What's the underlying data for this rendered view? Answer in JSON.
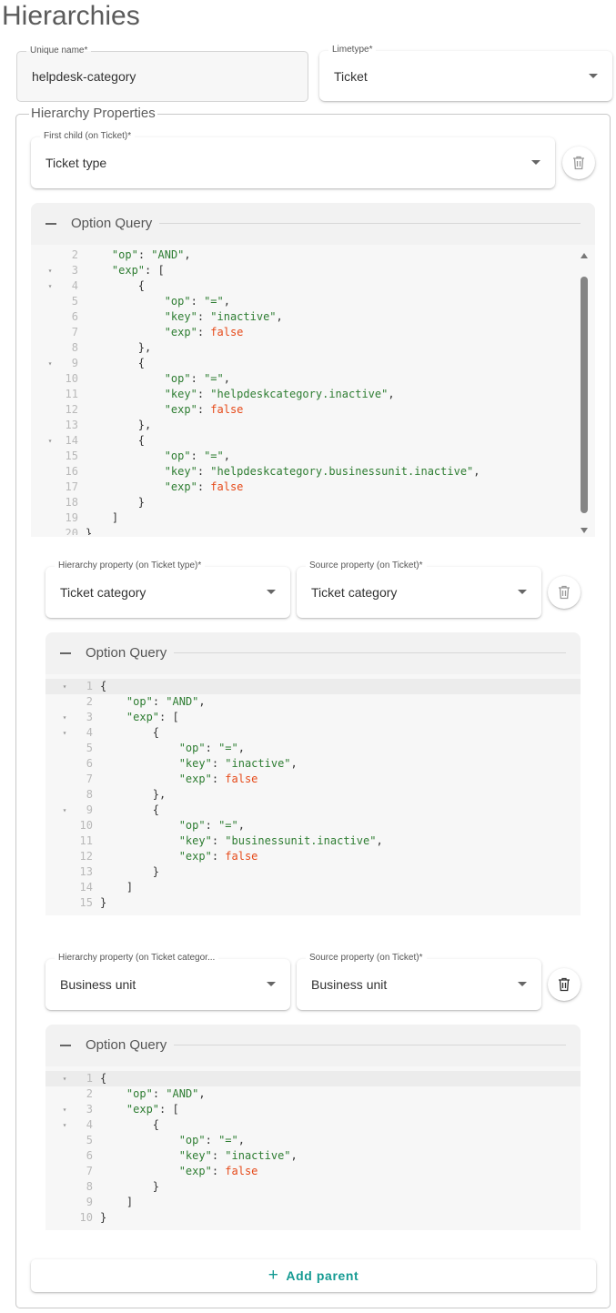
{
  "page": {
    "title": "Hierarchies"
  },
  "form": {
    "unique_name": {
      "label": "Unique name*",
      "value": "helpdesk-category"
    },
    "limetype": {
      "label": "Limetype*",
      "value": "Ticket"
    }
  },
  "hierarchy": {
    "legend": "Hierarchy Properties",
    "first_child": {
      "label": "First child (on Ticket)*",
      "value": "Ticket type",
      "option_query": {
        "title": "Option Query",
        "lines": [
          {
            "n": "2",
            "fold": "",
            "code": [
              [
                "t",
                "    "
              ],
              [
                "s",
                "\"op\""
              ],
              [
                "t",
                ": "
              ],
              [
                "s",
                "\"AND\""
              ],
              [
                "t",
                ","
              ]
            ]
          },
          {
            "n": "3",
            "fold": "▾",
            "code": [
              [
                "t",
                "    "
              ],
              [
                "s",
                "\"exp\""
              ],
              [
                "t",
                ": ["
              ]
            ]
          },
          {
            "n": "4",
            "fold": "▾",
            "code": [
              [
                "t",
                "        {"
              ]
            ]
          },
          {
            "n": "5",
            "fold": "",
            "code": [
              [
                "t",
                "            "
              ],
              [
                "s",
                "\"op\""
              ],
              [
                "t",
                ": "
              ],
              [
                "s",
                "\"=\""
              ],
              [
                "t",
                ","
              ]
            ]
          },
          {
            "n": "6",
            "fold": "",
            "code": [
              [
                "t",
                "            "
              ],
              [
                "s",
                "\"key\""
              ],
              [
                "t",
                ": "
              ],
              [
                "s",
                "\"inactive\""
              ],
              [
                "t",
                ","
              ]
            ]
          },
          {
            "n": "7",
            "fold": "",
            "code": [
              [
                "t",
                "            "
              ],
              [
                "s",
                "\"exp\""
              ],
              [
                "t",
                ": "
              ],
              [
                "b",
                "false"
              ]
            ]
          },
          {
            "n": "8",
            "fold": "",
            "code": [
              [
                "t",
                "        },"
              ]
            ]
          },
          {
            "n": "9",
            "fold": "▾",
            "code": [
              [
                "t",
                "        {"
              ]
            ]
          },
          {
            "n": "10",
            "fold": "",
            "code": [
              [
                "t",
                "            "
              ],
              [
                "s",
                "\"op\""
              ],
              [
                "t",
                ": "
              ],
              [
                "s",
                "\"=\""
              ],
              [
                "t",
                ","
              ]
            ]
          },
          {
            "n": "11",
            "fold": "",
            "code": [
              [
                "t",
                "            "
              ],
              [
                "s",
                "\"key\""
              ],
              [
                "t",
                ": "
              ],
              [
                "s",
                "\"helpdeskcategory.inactive\""
              ],
              [
                "t",
                ","
              ]
            ]
          },
          {
            "n": "12",
            "fold": "",
            "code": [
              [
                "t",
                "            "
              ],
              [
                "s",
                "\"exp\""
              ],
              [
                "t",
                ": "
              ],
              [
                "b",
                "false"
              ]
            ]
          },
          {
            "n": "13",
            "fold": "",
            "code": [
              [
                "t",
                "        },"
              ]
            ]
          },
          {
            "n": "14",
            "fold": "▾",
            "code": [
              [
                "t",
                "        {"
              ]
            ]
          },
          {
            "n": "15",
            "fold": "",
            "code": [
              [
                "t",
                "            "
              ],
              [
                "s",
                "\"op\""
              ],
              [
                "t",
                ": "
              ],
              [
                "s",
                "\"=\""
              ],
              [
                "t",
                ","
              ]
            ]
          },
          {
            "n": "16",
            "fold": "",
            "code": [
              [
                "t",
                "            "
              ],
              [
                "s",
                "\"key\""
              ],
              [
                "t",
                ": "
              ],
              [
                "s",
                "\"helpdeskcategory.businessunit.inactive\""
              ],
              [
                "t",
                ","
              ]
            ]
          },
          {
            "n": "17",
            "fold": "",
            "code": [
              [
                "t",
                "            "
              ],
              [
                "s",
                "\"exp\""
              ],
              [
                "t",
                ": "
              ],
              [
                "b",
                "false"
              ]
            ]
          },
          {
            "n": "18",
            "fold": "",
            "code": [
              [
                "t",
                "        }"
              ]
            ]
          },
          {
            "n": "19",
            "fold": "",
            "code": [
              [
                "t",
                "    ]"
              ]
            ]
          },
          {
            "n": "20",
            "fold": "",
            "code": [
              [
                "t",
                "}"
              ]
            ]
          }
        ]
      }
    },
    "levels": [
      {
        "hierarchy_label": "Hierarchy property (on Ticket type)*",
        "hierarchy_value": "Ticket category",
        "source_label": "Source property (on Ticket)*",
        "source_value": "Ticket category",
        "option_query": {
          "title": "Option Query",
          "lines": [
            {
              "n": "1",
              "fold": "▾",
              "active": true,
              "code": [
                [
                  "t",
                  "{"
                ]
              ]
            },
            {
              "n": "2",
              "fold": "",
              "code": [
                [
                  "t",
                  "    "
                ],
                [
                  "s",
                  "\"op\""
                ],
                [
                  "t",
                  ": "
                ],
                [
                  "s",
                  "\"AND\""
                ],
                [
                  "t",
                  ","
                ]
              ]
            },
            {
              "n": "3",
              "fold": "▾",
              "code": [
                [
                  "t",
                  "    "
                ],
                [
                  "s",
                  "\"exp\""
                ],
                [
                  "t",
                  ": ["
                ]
              ]
            },
            {
              "n": "4",
              "fold": "▾",
              "code": [
                [
                  "t",
                  "        {"
                ]
              ]
            },
            {
              "n": "5",
              "fold": "",
              "code": [
                [
                  "t",
                  "            "
                ],
                [
                  "s",
                  "\"op\""
                ],
                [
                  "t",
                  ": "
                ],
                [
                  "s",
                  "\"=\""
                ],
                [
                  "t",
                  ","
                ]
              ]
            },
            {
              "n": "6",
              "fold": "",
              "code": [
                [
                  "t",
                  "            "
                ],
                [
                  "s",
                  "\"key\""
                ],
                [
                  "t",
                  ": "
                ],
                [
                  "s",
                  "\"inactive\""
                ],
                [
                  "t",
                  ","
                ]
              ]
            },
            {
              "n": "7",
              "fold": "",
              "code": [
                [
                  "t",
                  "            "
                ],
                [
                  "s",
                  "\"exp\""
                ],
                [
                  "t",
                  ": "
                ],
                [
                  "b",
                  "false"
                ]
              ]
            },
            {
              "n": "8",
              "fold": "",
              "code": [
                [
                  "t",
                  "        },"
                ]
              ]
            },
            {
              "n": "9",
              "fold": "▾",
              "code": [
                [
                  "t",
                  "        {"
                ]
              ]
            },
            {
              "n": "10",
              "fold": "",
              "code": [
                [
                  "t",
                  "            "
                ],
                [
                  "s",
                  "\"op\""
                ],
                [
                  "t",
                  ": "
                ],
                [
                  "s",
                  "\"=\""
                ],
                [
                  "t",
                  ","
                ]
              ]
            },
            {
              "n": "11",
              "fold": "",
              "code": [
                [
                  "t",
                  "            "
                ],
                [
                  "s",
                  "\"key\""
                ],
                [
                  "t",
                  ": "
                ],
                [
                  "s",
                  "\"businessunit.inactive\""
                ],
                [
                  "t",
                  ","
                ]
              ]
            },
            {
              "n": "12",
              "fold": "",
              "code": [
                [
                  "t",
                  "            "
                ],
                [
                  "s",
                  "\"exp\""
                ],
                [
                  "t",
                  ": "
                ],
                [
                  "b",
                  "false"
                ]
              ]
            },
            {
              "n": "13",
              "fold": "",
              "code": [
                [
                  "t",
                  "        }"
                ]
              ]
            },
            {
              "n": "14",
              "fold": "",
              "code": [
                [
                  "t",
                  "    ]"
                ]
              ]
            },
            {
              "n": "15",
              "fold": "",
              "code": [
                [
                  "t",
                  "}"
                ]
              ]
            }
          ]
        }
      },
      {
        "hierarchy_label": "Hierarchy property (on Ticket categor...",
        "hierarchy_value": "Business unit",
        "source_label": "Source property (on Ticket)*",
        "source_value": "Business unit",
        "option_query": {
          "title": "Option Query",
          "lines": [
            {
              "n": "1",
              "fold": "▾",
              "active": true,
              "code": [
                [
                  "t",
                  "{"
                ]
              ]
            },
            {
              "n": "2",
              "fold": "",
              "code": [
                [
                  "t",
                  "    "
                ],
                [
                  "s",
                  "\"op\""
                ],
                [
                  "t",
                  ": "
                ],
                [
                  "s",
                  "\"AND\""
                ],
                [
                  "t",
                  ","
                ]
              ]
            },
            {
              "n": "3",
              "fold": "▾",
              "code": [
                [
                  "t",
                  "    "
                ],
                [
                  "s",
                  "\"exp\""
                ],
                [
                  "t",
                  ": ["
                ]
              ]
            },
            {
              "n": "4",
              "fold": "▾",
              "code": [
                [
                  "t",
                  "        {"
                ]
              ]
            },
            {
              "n": "5",
              "fold": "",
              "code": [
                [
                  "t",
                  "            "
                ],
                [
                  "s",
                  "\"op\""
                ],
                [
                  "t",
                  ": "
                ],
                [
                  "s",
                  "\"=\""
                ],
                [
                  "t",
                  ","
                ]
              ]
            },
            {
              "n": "6",
              "fold": "",
              "code": [
                [
                  "t",
                  "            "
                ],
                [
                  "s",
                  "\"key\""
                ],
                [
                  "t",
                  ": "
                ],
                [
                  "s",
                  "\"inactive\""
                ],
                [
                  "t",
                  ","
                ]
              ]
            },
            {
              "n": "7",
              "fold": "",
              "code": [
                [
                  "t",
                  "            "
                ],
                [
                  "s",
                  "\"exp\""
                ],
                [
                  "t",
                  ": "
                ],
                [
                  "b",
                  "false"
                ]
              ]
            },
            {
              "n": "8",
              "fold": "",
              "code": [
                [
                  "t",
                  "        }"
                ]
              ]
            },
            {
              "n": "9",
              "fold": "",
              "code": [
                [
                  "t",
                  "    ]"
                ]
              ]
            },
            {
              "n": "10",
              "fold": "",
              "code": [
                [
                  "t",
                  "}"
                ]
              ]
            }
          ]
        }
      }
    ],
    "add_parent": "Add parent"
  },
  "colors": {
    "accent": "#169b93",
    "json_string": "#2e7d32",
    "json_boolean": "#e64a19"
  },
  "icons": {
    "delete": "trash-icon",
    "collapse": "minus-icon",
    "dropdown": "chevron-down-icon",
    "add": "plus-icon"
  }
}
